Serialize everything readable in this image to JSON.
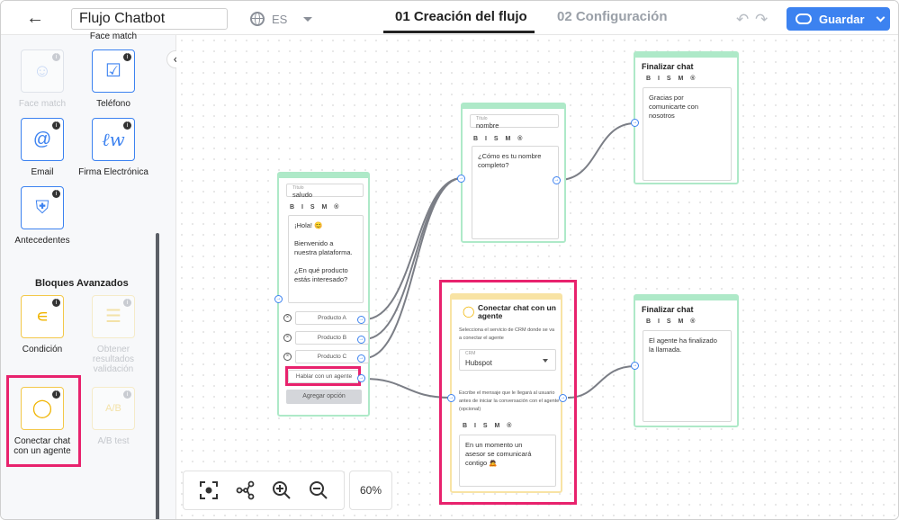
{
  "header": {
    "flow_name": "Flujo Chatbot",
    "language": "ES",
    "tabs": [
      {
        "label": "01 Creación del flujo",
        "active": true
      },
      {
        "label": "02 Configuración",
        "active": false
      }
    ],
    "save_label": "Guardar",
    "accent_color": "#3c82f0"
  },
  "sidebar": {
    "top_label": "Face match",
    "blocks": [
      {
        "label": "Face match",
        "icon": "face-icon",
        "enabled": false
      },
      {
        "label": "Teléfono",
        "icon": "phone-icon",
        "enabled": true
      },
      {
        "label": "Email",
        "icon": "at-icon",
        "enabled": true
      },
      {
        "label": "Firma Electrónica",
        "icon": "signature-icon",
        "enabled": true
      },
      {
        "label": "Antecedentes",
        "icon": "shield-icon",
        "enabled": true
      }
    ],
    "advanced_title": "Bloques Avanzados",
    "advanced_blocks": [
      {
        "label": "Condición",
        "icon": "branch-icon",
        "enabled": true
      },
      {
        "label": "Obtener resultados validación",
        "icon": "list-icon",
        "enabled": false
      },
      {
        "label": "Conectar chat con un agente",
        "icon": "headset-icon",
        "enabled": true
      },
      {
        "label": "A/B test",
        "icon": "ab-icon",
        "enabled": false
      }
    ],
    "ab_glyph": "A/B"
  },
  "nodes": {
    "saludo": {
      "field_label": "Título",
      "field_value": "saludo",
      "format": "B I S M ®",
      "message": "¡Hola! 😊\n\nBienvenido a\nnuestra plataforma.\n\n¿En qué producto\nestás interesado?",
      "options": [
        "Producto A",
        "Producto B",
        "Producto C",
        "Hablar con un agente"
      ],
      "add_option": "Agregar opción"
    },
    "nombre": {
      "field_label": "Título",
      "field_value": "nombre",
      "format": "B I S M ®",
      "message": "¿Cómo es tu nombre\ncompleto?"
    },
    "finalizar1": {
      "title": "Finalizar chat",
      "format": "B I S M ®",
      "message": "Gracias por\ncomunicarte con\nnosotros"
    },
    "agente": {
      "title": "Conectar chat con un agente",
      "crm_help": "Selecciona el servicio de CRM donde se va a conectar el agente",
      "crm_label": "CRM",
      "crm_value": "Hubspot",
      "msg_help": "Escribe el mensaje que le llegará al usuario antes de iniciar la conversación con el agente (opcional)",
      "format": "B I S M ®",
      "message": "En un momento un\nasesor se comunicará\ncontigo 🙇"
    },
    "finalizar2": {
      "title": "Finalizar chat",
      "format": "B I S M ®",
      "message": "El agente ha finalizado\nla llamada."
    }
  },
  "toolbar": {
    "zoom": "60%",
    "tools": [
      "focus-icon",
      "share-icon",
      "zoom-in-icon",
      "zoom-out-icon"
    ]
  },
  "highlight_color": "#e8226d"
}
